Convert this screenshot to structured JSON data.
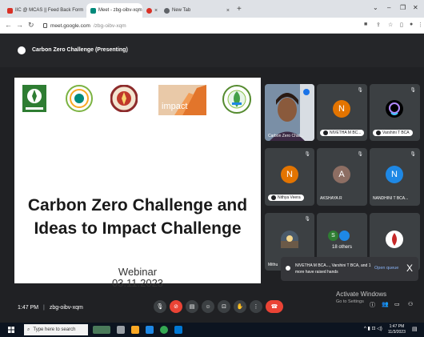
{
  "browser": {
    "tabs": [
      {
        "label": "IIC @ MCAS || Feed Back Form",
        "active": false
      },
      {
        "label": "Meet - zbg-oibv-xqm",
        "active": true
      },
      {
        "label": "",
        "active": false
      },
      {
        "label": "New Tab",
        "active": false
      }
    ],
    "new_tab_glyph": "+",
    "url_host": "meet.google.com",
    "url_path": "/zbg-oibv-xqm"
  },
  "meet": {
    "presentation_title": "Carbon Zero Challenge (Presenting)",
    "slide": {
      "headline": "Carbon Zero Challenge and Ideas to Impact Challenge",
      "subtitle_line1": "Webinar",
      "subtitle_line2": "03.11.2023",
      "logos": [
        "logo-green",
        "logo-circle",
        "logo-emblem",
        "logo-impact",
        "logo-school"
      ],
      "logo_impact_text": "impact"
    },
    "participants": [
      {
        "name": "Carbon Zero Chal...",
        "initial": "",
        "color": "#5a4a3a"
      },
      {
        "name": "NIVETHA M BC...",
        "initial": "N",
        "color": "#e37400"
      },
      {
        "name": "Varshini T BCA",
        "initial": "",
        "color": "#000000"
      },
      {
        "name": "Nithya Veera",
        "initial": "N",
        "color": "#e37400"
      },
      {
        "name": "AKSHAYA R",
        "initial": "A",
        "color": "#8d6e63"
      },
      {
        "name": "NANDHINI T BCA...",
        "initial": "N",
        "color": "#1e88e5"
      },
      {
        "name": "Mithu",
        "initial": "",
        "color": "#4a5a6a"
      },
      {
        "name": "18 others",
        "initial": "S",
        "color": "#2e7d32"
      },
      {
        "name": "",
        "initial": "",
        "color": "#ffffff"
      }
    ],
    "raised_hands": {
      "text": "NIVETHA M BCA..., Varshini T BCA, and 1 more have raised hands",
      "action": "Open queue",
      "close": "X"
    },
    "time": "1:47 PM",
    "separator": "|",
    "meeting_code": "zbg-oibv-xqm",
    "activate_title": "Activate Windows",
    "activate_sub": "Go to Settings"
  },
  "taskbar": {
    "search_placeholder": "Type here to search",
    "time": "1:47 PM",
    "date": "11/3/2023"
  }
}
